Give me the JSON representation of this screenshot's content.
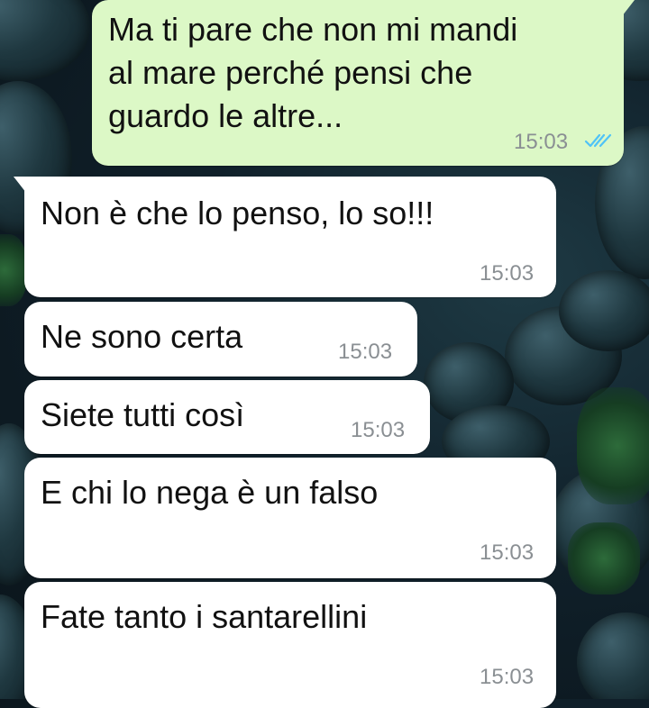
{
  "conversation": {
    "messages": [
      {
        "direction": "outgoing",
        "lines": [
          "Ma ti pare che non mi mandi",
          "al mare perché pensi che",
          "guardo le altre..."
        ],
        "time": "15:03",
        "status_icon": "double-check-read-icon"
      },
      {
        "direction": "incoming",
        "text": "Non è che lo penso, lo so!!!",
        "time": "15:03"
      },
      {
        "direction": "incoming",
        "text": "Ne sono certa",
        "time": "15:03"
      },
      {
        "direction": "incoming",
        "text": "Siete tutti così",
        "time": "15:03"
      },
      {
        "direction": "incoming",
        "text": "E chi lo nega è un falso",
        "time": "15:03"
      },
      {
        "direction": "incoming",
        "text": "Fate tanto i santarellini",
        "time": "15:03"
      }
    ]
  },
  "colors": {
    "outgoing_bubble": "#dcf8c6",
    "incoming_bubble": "#ffffff",
    "read_ticks": "#4fc3f7",
    "timestamp": "#8a8f93"
  }
}
